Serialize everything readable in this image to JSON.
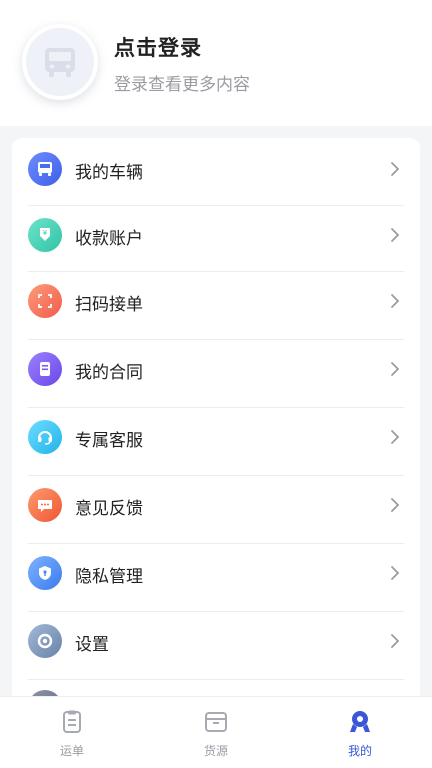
{
  "header": {
    "title": "点击登录",
    "subtitle": "登录查看更多内容"
  },
  "menu": [
    {
      "label": "我的车辆",
      "icon": "truck-icon",
      "color": "#4a6cf0"
    },
    {
      "label": "收款账户",
      "icon": "receive-payment-icon",
      "color": "#3ecfb0"
    },
    {
      "label": "扫码接单",
      "icon": "scan-icon",
      "color": "#f4705a"
    },
    {
      "label": "我的合同",
      "icon": "contract-icon",
      "color": "#7b5cf0"
    },
    {
      "label": "专属客服",
      "icon": "headset-icon",
      "color": "#30c6f0"
    },
    {
      "label": "意见反馈",
      "icon": "feedback-icon",
      "color": "#f46a3c"
    },
    {
      "label": "隐私管理",
      "icon": "privacy-shield-icon",
      "color": "#4a8df5"
    },
    {
      "label": "设置",
      "icon": "settings-icon",
      "color": "#7d96b8"
    }
  ],
  "tabs": [
    {
      "label": "运单",
      "icon": "waybill-icon",
      "active": false
    },
    {
      "label": "货源",
      "icon": "cargo-source-icon",
      "active": false
    },
    {
      "label": "我的",
      "icon": "profile-icon",
      "active": true
    }
  ],
  "colors": {
    "accent": "#3a57d8",
    "inactive": "#9a9ca3"
  }
}
